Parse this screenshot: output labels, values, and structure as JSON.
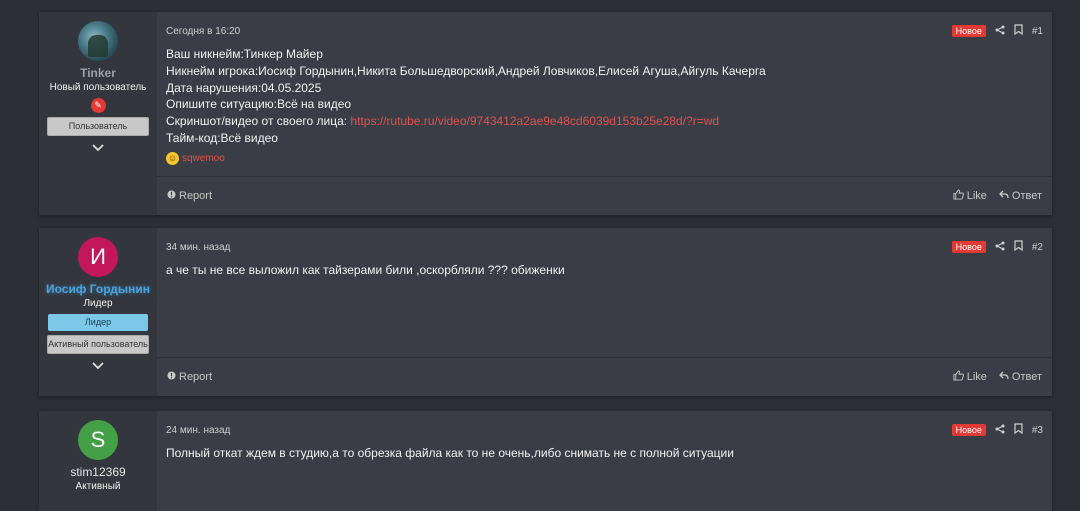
{
  "posts": [
    {
      "number": "#1",
      "date": "Сегодня в 16:20",
      "new_label": "Новое",
      "user": {
        "name": "Tinker",
        "title": "Новый пользователь",
        "banners": [
          "Пользователь"
        ]
      },
      "lines": [
        "Ваш никнейм:Тинкер Майер",
        "Никнейм игрока:Иосиф Гордынин,Никита Большедворский,Андрей Ловчиков,Елисей Агуша,Айгуль Качерга",
        "Дата нарушения:04.05.2025",
        "Опишите ситуацию:Всё на видео"
      ],
      "screenshot_label": "Скриншот/видео от своего лица: ",
      "screenshot_link": "https://rutube.ru/video/9743412a2ae9e48cd6039d153b25e28d/?r=wd",
      "timecode_line": "Тайм-код:Всё видео",
      "reaction_user": "sqwemoo",
      "footer": {
        "report": "Report",
        "like": "Like",
        "reply": "Ответ"
      }
    },
    {
      "number": "#2",
      "date": "34 мин. назад",
      "new_label": "Новое",
      "user": {
        "initial": "И",
        "name": "Иосиф Гордынин",
        "title": "Лидер",
        "banners": [
          "Лидер",
          "Активный пользователь"
        ]
      },
      "text": "а че ты не все выложил как тайзерами били ,оскорбляли ??? обиженки",
      "footer": {
        "report": "Report",
        "like": "Like",
        "reply": "Ответ"
      }
    },
    {
      "number": "#3",
      "date": "24 мин. назад",
      "new_label": "Новое",
      "user": {
        "initial": "S",
        "name": "stim12369",
        "title": "Активный"
      },
      "text": "Полный откат ждем в студию,а то обрезка файла как то не очень,либо снимать не с полной ситуации"
    }
  ],
  "icons": {
    "share": "share-icon",
    "bookmark": "bookmark-icon",
    "report": "report-icon",
    "like": "thumbs-up-icon",
    "reply": "reply-icon",
    "expand": "chevron-down-icon"
  },
  "colors": {
    "new_badge": "#e53935",
    "link": "#e0524d",
    "leader_name": "#4aa3df",
    "avatar_pink": "#c2185b",
    "avatar_green": "#43a047"
  }
}
